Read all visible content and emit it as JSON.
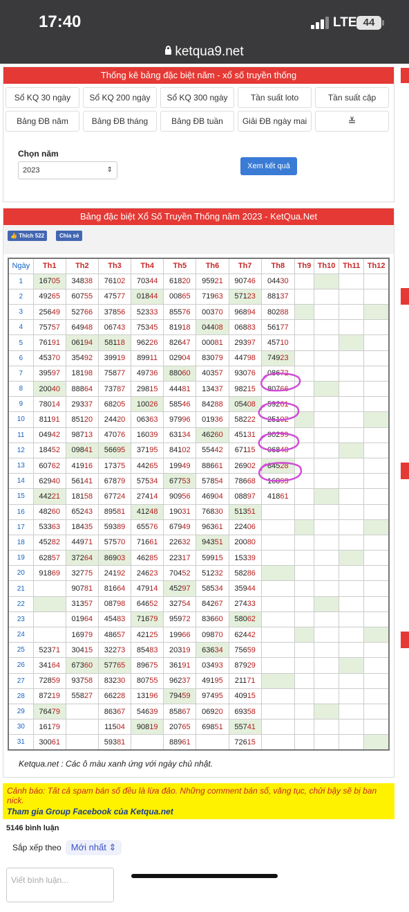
{
  "status": {
    "time": "17:40",
    "network": "LTE",
    "battery": "44"
  },
  "url": "ketqua9.net",
  "stats_panel": {
    "title": "Thống kê bảng đặc biệt năm - xổ số truyền thống",
    "buttons": [
      "Sổ KQ 30 ngày",
      "Sổ KQ 200 ngày",
      "Sổ KQ 300 ngày",
      "Tần suất loto",
      "Tần suất cặp",
      "Bảng ĐB năm",
      "Bảng ĐB tháng",
      "Bảng ĐB tuần",
      "Giải ĐB ngày mai",
      ""
    ],
    "more_icon": "double-chevron-down-icon",
    "year_label": "Chọn năm",
    "year_value": "2023",
    "submit_label": "Xem kết quả"
  },
  "results_panel": {
    "title": "Bảng đặc biệt Xổ Số Truyền Thống năm 2023 - KetQua.Net",
    "like_label": "Thích 522",
    "share_label": "Chia sẻ",
    "headers": [
      "Ngày",
      "Th1",
      "Th2",
      "Th3",
      "Th4",
      "Th5",
      "Th6",
      "Th7",
      "Th8",
      "Th9",
      "Th10",
      "Th11",
      "Th12"
    ],
    "rows": [
      [
        "1",
        "16705",
        "34838",
        "76102",
        "70344",
        "61820",
        "95921",
        "90746",
        "04430",
        "",
        "",
        "",
        ""
      ],
      [
        "2",
        "49265",
        "60755",
        "47577",
        "01844",
        "00865",
        "71963",
        "57123",
        "88137",
        "",
        "",
        "",
        ""
      ],
      [
        "3",
        "25649",
        "52766",
        "37856",
        "52333",
        "85576",
        "00370",
        "96894",
        "80288",
        "",
        "",
        "",
        ""
      ],
      [
        "4",
        "75757",
        "64948",
        "06743",
        "75345",
        "81918",
        "04408",
        "06883",
        "56177",
        "",
        "",
        "",
        ""
      ],
      [
        "5",
        "76191",
        "06194",
        "58118",
        "96226",
        "82647",
        "00081",
        "29397",
        "45710",
        "",
        "",
        "",
        ""
      ],
      [
        "6",
        "45370",
        "35492",
        "39919",
        "89911",
        "02904",
        "83079",
        "44798",
        "74923",
        "",
        "",
        "",
        ""
      ],
      [
        "7",
        "39597",
        "18198",
        "75877",
        "49736",
        "88060",
        "40357",
        "93076",
        "08672",
        "",
        "",
        "",
        ""
      ],
      [
        "8",
        "20040",
        "88864",
        "73787",
        "29815",
        "44481",
        "13437",
        "98215",
        "80766",
        "",
        "",
        "",
        ""
      ],
      [
        "9",
        "78014",
        "29337",
        "68205",
        "10026",
        "58546",
        "84288",
        "05408",
        "59261",
        "",
        "",
        "",
        ""
      ],
      [
        "10",
        "81191",
        "85120",
        "24420",
        "06363",
        "97996",
        "01936",
        "58222",
        "25102",
        "",
        "",
        "",
        ""
      ],
      [
        "11",
        "04942",
        "98713",
        "47076",
        "16039",
        "63134",
        "46260",
        "45131",
        "90299",
        "",
        "",
        "",
        ""
      ],
      [
        "12",
        "18452",
        "09841",
        "56695",
        "37195",
        "84102",
        "55442",
        "67115",
        "06848",
        "",
        "",
        "",
        ""
      ],
      [
        "13",
        "60762",
        "41916",
        "17375",
        "44265",
        "19949",
        "88661",
        "26902",
        "84528",
        "",
        "",
        "",
        ""
      ],
      [
        "14",
        "62940",
        "56141",
        "67879",
        "57534",
        "67753",
        "57854",
        "78668",
        "16893",
        "",
        "",
        "",
        ""
      ],
      [
        "15",
        "44221",
        "18158",
        "67724",
        "27414",
        "90956",
        "46904",
        "08897",
        "41861",
        "",
        "",
        "",
        ""
      ],
      [
        "16",
        "48260",
        "65243",
        "89581",
        "41248",
        "19031",
        "76830",
        "51351",
        "",
        "",
        "",
        "",
        ""
      ],
      [
        "17",
        "53363",
        "18435",
        "59389",
        "65576",
        "67949",
        "96361",
        "22406",
        "",
        "",
        "",
        "",
        ""
      ],
      [
        "18",
        "45282",
        "44971",
        "57570",
        "71661",
        "22632",
        "94351",
        "20080",
        "",
        "",
        "",
        "",
        ""
      ],
      [
        "19",
        "62857",
        "37264",
        "86903",
        "46285",
        "22317",
        "59915",
        "15339",
        "",
        "",
        "",
        "",
        ""
      ],
      [
        "20",
        "91869",
        "32775",
        "24192",
        "24623",
        "70452",
        "51232",
        "58286",
        "",
        "",
        "",
        "",
        ""
      ],
      [
        "21",
        "",
        "90781",
        "81664",
        "47914",
        "45297",
        "58534",
        "35944",
        "",
        "",
        "",
        "",
        ""
      ],
      [
        "22",
        "",
        "31357",
        "08798",
        "64652",
        "32754",
        "84267",
        "27433",
        "",
        "",
        "",
        "",
        ""
      ],
      [
        "23",
        "",
        "01964",
        "45483",
        "71679",
        "95972",
        "83660",
        "58062",
        "",
        "",
        "",
        "",
        ""
      ],
      [
        "24",
        "",
        "16979",
        "48657",
        "42125",
        "19966",
        "09870",
        "62442",
        "",
        "",
        "",
        "",
        ""
      ],
      [
        "25",
        "52371",
        "30415",
        "32273",
        "85483",
        "20319",
        "63634",
        "75659",
        "",
        "",
        "",
        "",
        ""
      ],
      [
        "26",
        "34164",
        "67360",
        "57765",
        "89675",
        "36191",
        "03493",
        "87929",
        "",
        "",
        "",
        "",
        ""
      ],
      [
        "27",
        "72859",
        "93758",
        "83230",
        "80755",
        "96237",
        "49195",
        "21171",
        "",
        "",
        "",
        "",
        ""
      ],
      [
        "28",
        "87219",
        "55827",
        "66228",
        "13196",
        "79459",
        "97495",
        "40915",
        "",
        "",
        "",
        "",
        ""
      ],
      [
        "29",
        "76479",
        "",
        "86367",
        "54639",
        "85867",
        "06920",
        "69358",
        "",
        "",
        "",
        "",
        ""
      ],
      [
        "30",
        "16179",
        "",
        "11504",
        "90819",
        "20765",
        "69851",
        "55741",
        "",
        "",
        "",
        "",
        ""
      ],
      [
        "31",
        "30061",
        "",
        "59381",
        "",
        "88961",
        "",
        "72615",
        "",
        "",
        "",
        "",
        ""
      ]
    ],
    "note": "Ketqua.net : Các ô màu xanh ứng với ngày chủ nhật."
  },
  "warning": {
    "text": "Cảnh báo: Tất cả spam bán số đều là lừa đảo. Những comment bán số, văng tục, chửi bậy sẽ bị ban nick.",
    "link": "Tham gia Group Facebook của Ketqua.net"
  },
  "comments": {
    "count_label": "5146 bình luận",
    "sort_label": "Sắp xếp theo",
    "sort_value": "Mới nhất",
    "placeholder": "Viết bình luận..."
  },
  "colors": {
    "header_red": "#e53935",
    "sunday_green": "#e4f0dc",
    "day_blue": "#1565c0",
    "circle": "#d04ed6"
  }
}
